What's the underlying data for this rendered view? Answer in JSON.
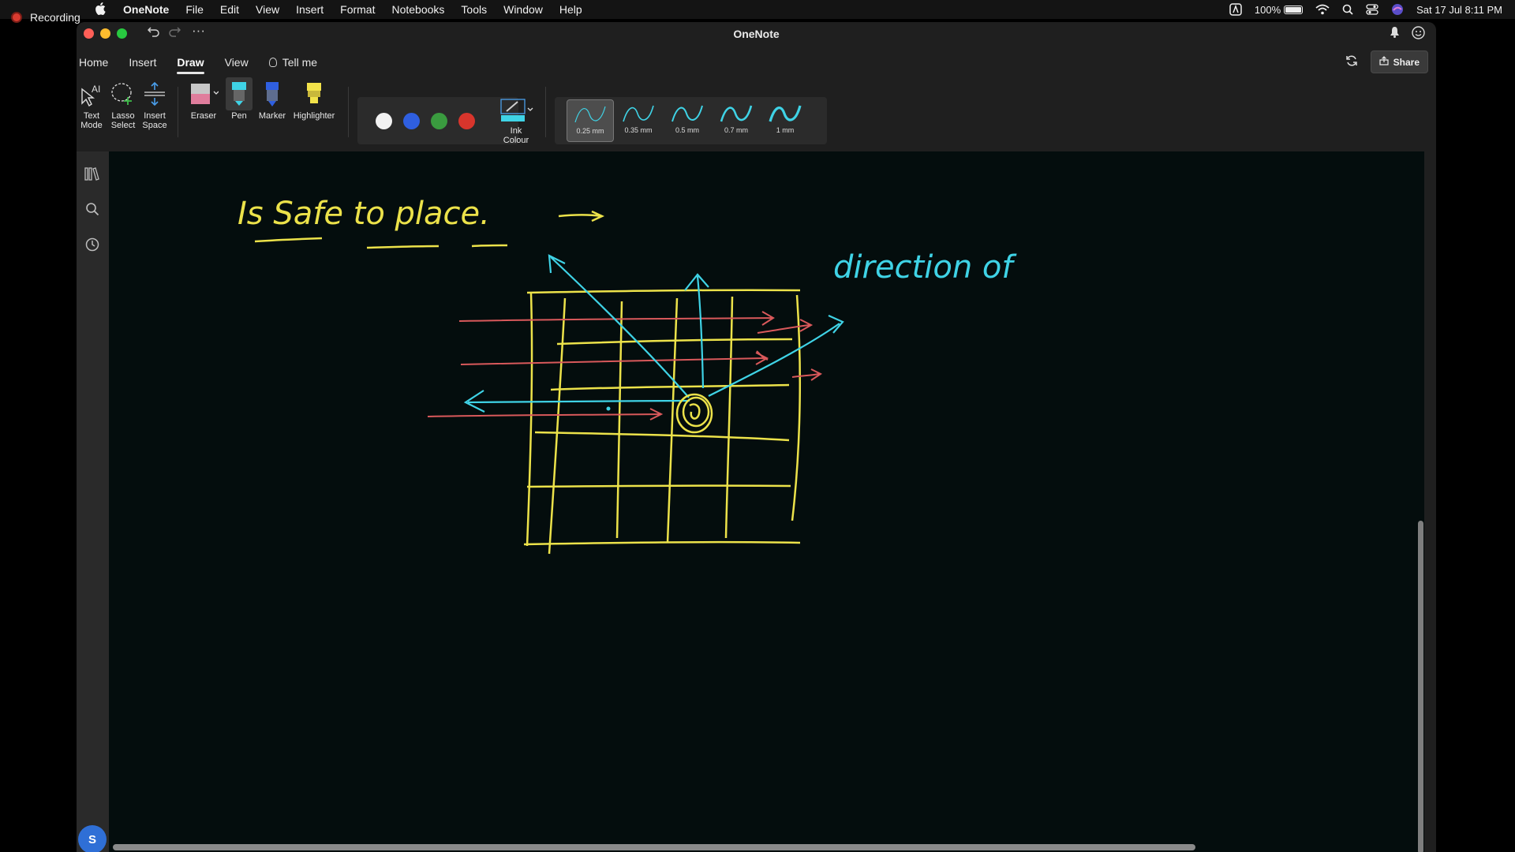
{
  "menubar": {
    "app_name": "OneNote",
    "items": [
      "File",
      "Edit",
      "View",
      "Insert",
      "Format",
      "Notebooks",
      "Tools",
      "Window",
      "Help"
    ],
    "battery": "100%",
    "datetime": "Sat 17 Jul  8:11 PM"
  },
  "recording": {
    "label": "Recording"
  },
  "window": {
    "title": "OneNote"
  },
  "ribbon": {
    "tabs": [
      {
        "label": "Home",
        "active": false
      },
      {
        "label": "Insert",
        "active": false
      },
      {
        "label": "Draw",
        "active": true
      },
      {
        "label": "View",
        "active": false
      }
    ],
    "tell_me": "Tell me",
    "share": "Share"
  },
  "draw_tools": {
    "text_mode": "Text\nMode",
    "lasso_select": "Lasso\nSelect",
    "insert_space": "Insert\nSpace",
    "eraser": "Eraser",
    "pen": "Pen",
    "marker": "Marker",
    "highlighter": "Highlighter",
    "ink_colour": "Ink\nColour"
  },
  "colors": {
    "swatches": [
      "#f2f2f2",
      "#2f5fe0",
      "#3a9b3f",
      "#d8352c"
    ],
    "ink_selected": "#3fd3e6",
    "ink_yellow": "#ece24a",
    "ink_red": "#d9595b",
    "canvas_bg": "#040d0d"
  },
  "thickness": {
    "options": [
      "0.25 mm",
      "0.35 mm",
      "0.5 mm",
      "0.7 mm",
      "1 mm"
    ],
    "selected": "0.25 mm"
  },
  "avatar": {
    "initial": "S"
  },
  "canvas": {
    "heading": "Is Safe to place.",
    "side_note": "direction of"
  }
}
